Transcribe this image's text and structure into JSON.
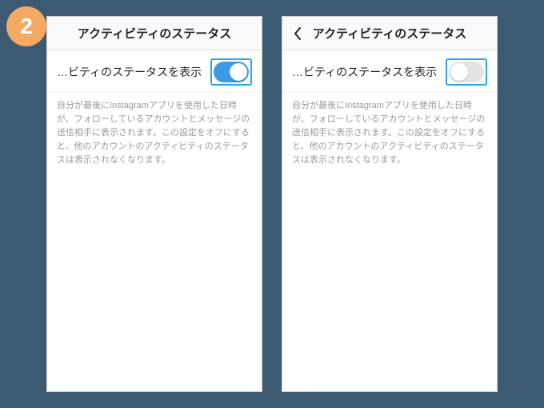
{
  "step_number": "2",
  "screens": [
    {
      "header_title": "アクティビティのステータス",
      "has_back": false,
      "setting_label": "…ビティのステータスを表示",
      "toggle_on": true,
      "description": "自分が最後にInstagramアプリを使用した日時が、フォローしているアカウントとメッセージの送信相手に表示されます。この設定をオフにすると、他のアカウントのアクティビティのステータスは表示されなくなります。"
    },
    {
      "header_title": "アクティビティのステータス",
      "has_back": true,
      "setting_label": "…ビティのステータスを表示",
      "toggle_on": false,
      "description": "自分が最後にInstagramアプリを使用した日時が、フォローしているアカウントとメッセージの送信相手に表示されます。この設定をオフにすると、他のアカウントのアクティビティのステータスは表示されなくなります。"
    }
  ]
}
